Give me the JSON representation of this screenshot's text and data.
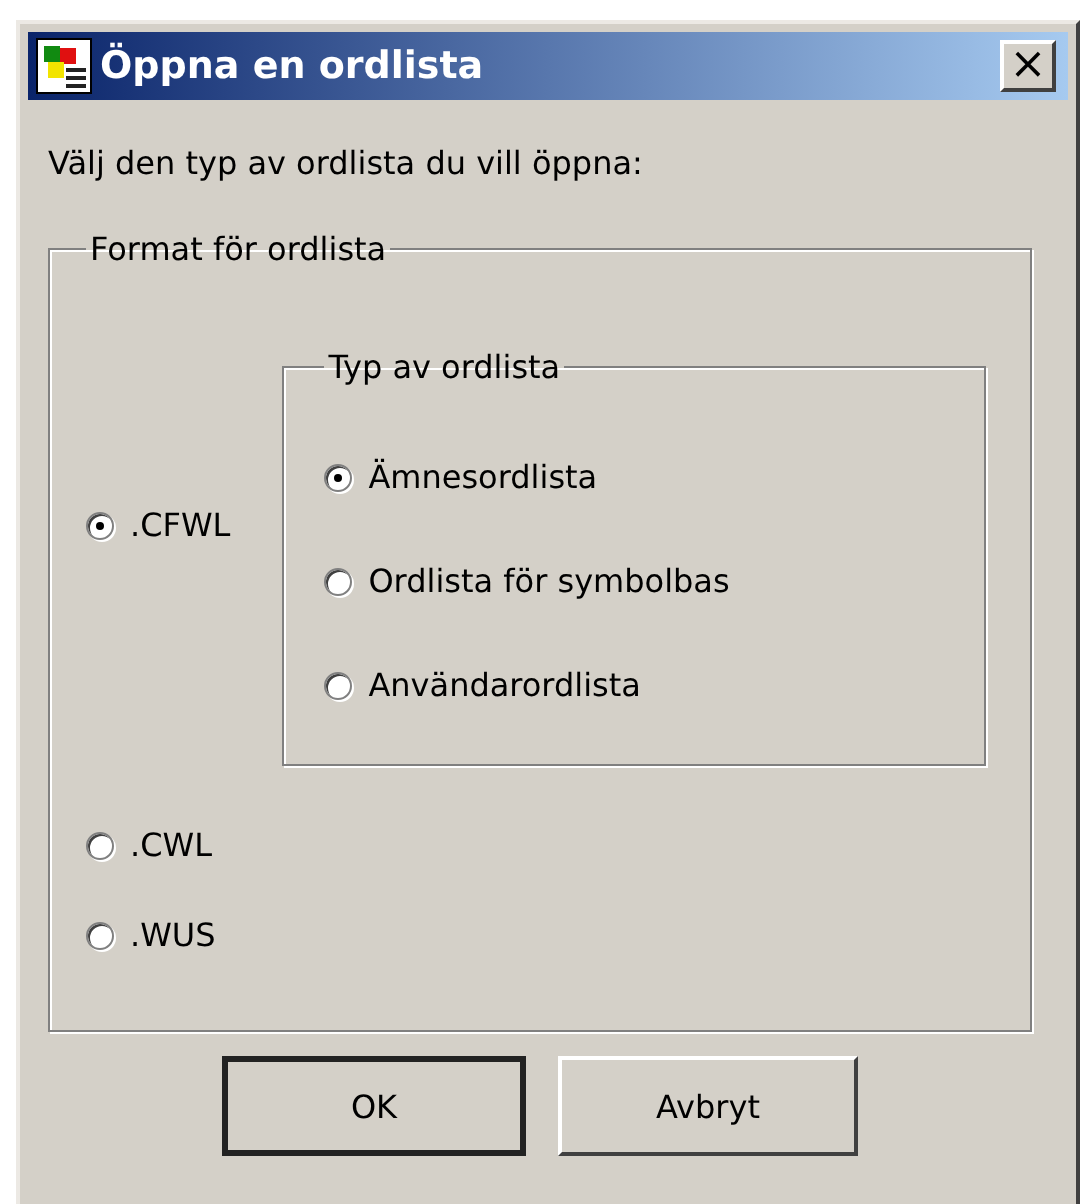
{
  "window": {
    "title": "Öppna en ordlista",
    "close": "×"
  },
  "instruction": "Välj den typ av ordlista du vill öppna:",
  "format_group": {
    "legend": "Format för ordlista",
    "options": [
      {
        "label": ".CFWL",
        "selected": true,
        "subgroup": {
          "legend": "Typ av ordlista",
          "options": [
            {
              "label": "Ämnesordlista",
              "selected": true
            },
            {
              "label": "Ordlista för symbolbas",
              "selected": false
            },
            {
              "label": "Användarordlista",
              "selected": false
            }
          ]
        }
      },
      {
        "label": ".CWL",
        "selected": false
      },
      {
        "label": ".WUS",
        "selected": false
      }
    ]
  },
  "buttons": [
    {
      "label": "OK",
      "default": true
    },
    {
      "label": "Avbryt",
      "default": false
    }
  ]
}
